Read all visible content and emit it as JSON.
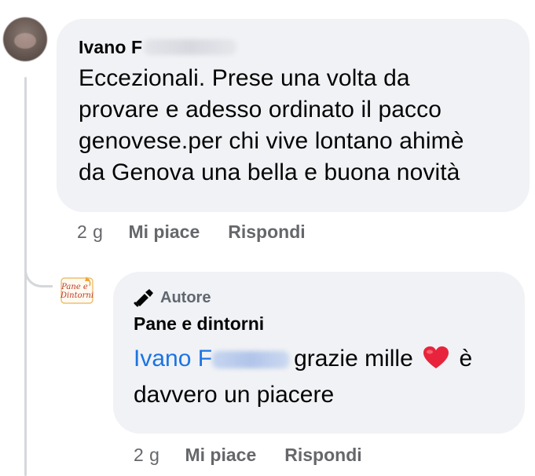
{
  "comment": {
    "author_visible": "Ivano F",
    "text": "Eccezionali. Prese una volta da provare e adesso ordinato il pacco genovese.per chi vive lontano ahimè da Genova una bella e buona novità",
    "lines": [
      "Eccezionali. Prese una volta da",
      "provare e adesso ordinato il pacco",
      "genovese.per chi vive lontano ahimè",
      "da Genova una bella e buona novità"
    ],
    "time": "2 g",
    "like_label": "Mi piace",
    "reply_label": "Rispondi"
  },
  "reply": {
    "badge_label": "Autore",
    "author": "Pane e dintorni",
    "mention_visible": "Ivano F",
    "text_after_mention": "grazie mille",
    "text_after_heart": "è",
    "line2": "davvero un piacere",
    "time": "2 g",
    "like_label": "Mi piace",
    "reply_label": "Rispondi",
    "avatar_logo_text": [
      "Pane e",
      "Dintorni"
    ]
  },
  "colors": {
    "bubble": "#f0f2f5",
    "mention": "#1b74e4",
    "meta": "#65676b",
    "heart": "#e8243c"
  },
  "icons": {
    "author_badge": "megaphone-icon",
    "heart": "heart-icon"
  }
}
